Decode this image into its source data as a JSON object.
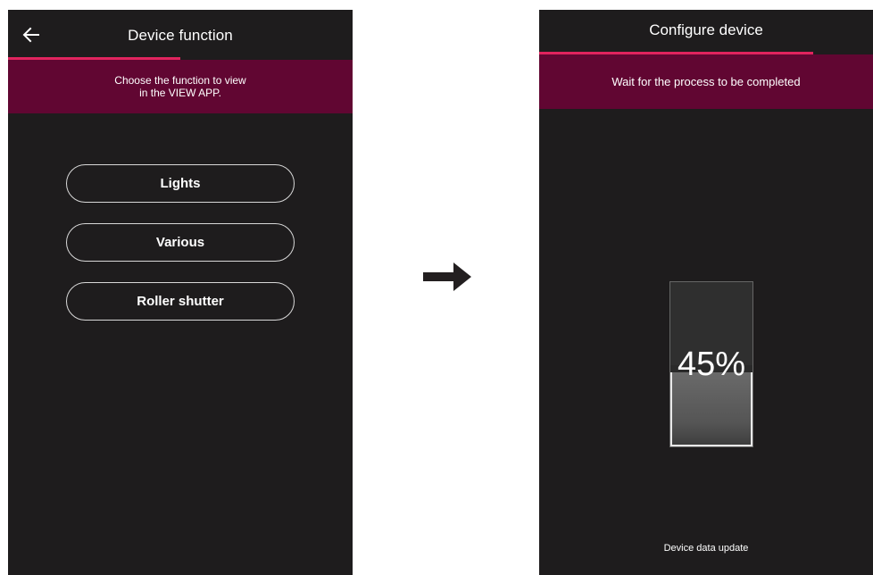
{
  "left_screen": {
    "title": "Device function",
    "back_icon": "arrow-left-icon",
    "progress": 0.5,
    "banner": {
      "line1": "Choose the function to view",
      "line2": "in the VIEW APP."
    },
    "functions": [
      {
        "label": "Lights"
      },
      {
        "label": "Various"
      },
      {
        "label": "Roller shutter"
      }
    ]
  },
  "transition": {
    "icon": "arrow-right-icon"
  },
  "right_screen": {
    "title": "Configure device",
    "progress": 0.82,
    "banner": "Wait for the process to be completed",
    "gauge": {
      "percent_text": "45%",
      "value": 0.45
    },
    "status": "Device data update"
  },
  "colors": {
    "screen_bg": "#1e1c1d",
    "banner_bg": "#610632",
    "accent": "#e0245e",
    "text": "#ffffff"
  }
}
